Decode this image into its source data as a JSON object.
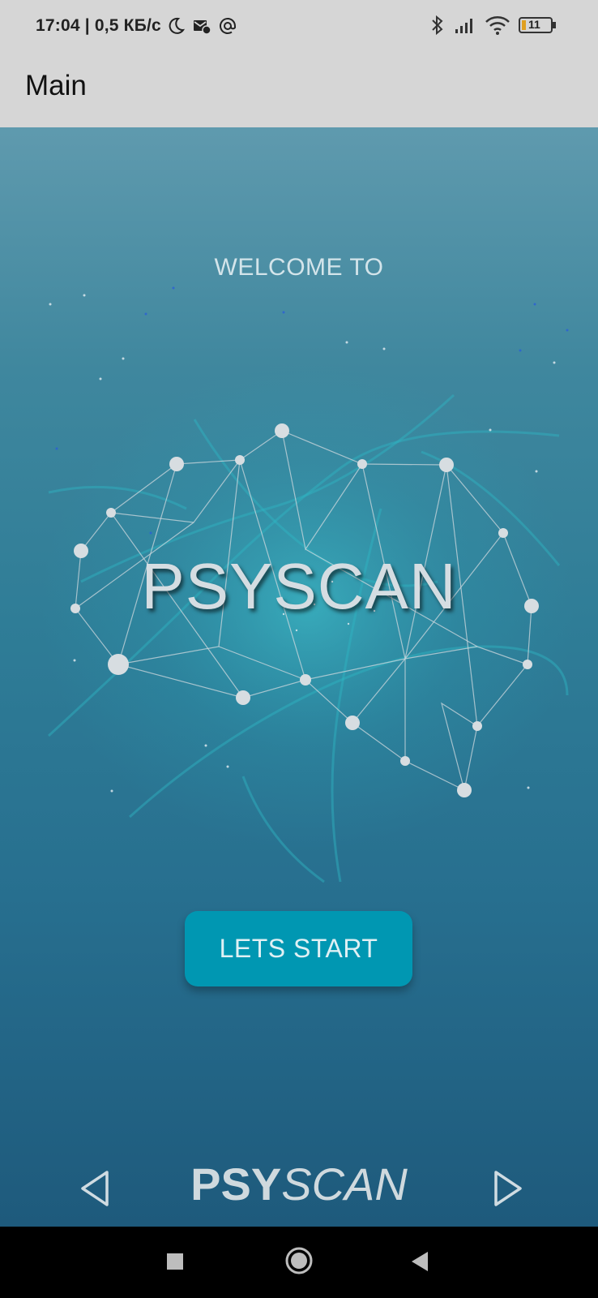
{
  "status_bar": {
    "time_speed": "17:04 | 0,5 КБ/с",
    "icons_left": [
      "moon-icon",
      "mail-icon",
      "at-icon"
    ],
    "icons_right": [
      "bluetooth-icon",
      "signal-icon",
      "wifi-icon",
      "battery-icon"
    ],
    "battery_level": "11"
  },
  "app_bar": {
    "title": "Main"
  },
  "main": {
    "welcome_text": "WELCOME TO",
    "brand_title": "PSYSCAN",
    "start_button_label": "LETS START"
  },
  "footer": {
    "logo_bold": "PSY",
    "logo_italic": "SCAN",
    "prev_icon": "triangle-left-outline-icon",
    "next_icon": "triangle-right-outline-icon"
  },
  "system_nav": {
    "icons": [
      "recents-square-icon",
      "home-circle-icon",
      "back-triangle-icon"
    ]
  },
  "colors": {
    "status_bg": "#d6d6d6",
    "gradient_top": "#5f9aae",
    "gradient_bottom": "#1e5a7c",
    "button": "#0097b2",
    "title_text": "#d5dde2"
  }
}
